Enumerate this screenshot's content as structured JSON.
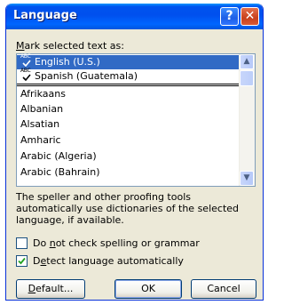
{
  "window": {
    "title": "Language",
    "help_glyph": "?",
    "close_glyph": "✕"
  },
  "list": {
    "label_mnemonic": "M",
    "label_rest": "ark selected text as:",
    "selected_items": [
      {
        "label": "English (U.S.)",
        "icon": "spell-check-icon",
        "selected": true
      },
      {
        "label": "Spanish (Guatemala)",
        "icon": "spell-check-icon",
        "selected": false
      }
    ],
    "items": [
      "Afrikaans",
      "Albanian",
      "Alsatian",
      "Amharic",
      "Arabic (Algeria)",
      "Arabic (Bahrain)"
    ],
    "abc_text": "ABC"
  },
  "info_text": "The speller and other proofing tools automatically use dictionaries of the selected language, if available.",
  "options": {
    "no_spell_check": {
      "pre": "Do ",
      "mnemonic": "n",
      "post": "ot check spelling or grammar",
      "checked": false
    },
    "detect_language": {
      "pre": "D",
      "mnemonic": "e",
      "post": "tect language automatically",
      "checked": true
    }
  },
  "buttons": {
    "default": {
      "mnemonic": "D",
      "rest": "efault..."
    },
    "ok": "OK",
    "cancel": "Cancel"
  },
  "colors": {
    "title_gradient": "#0050ee",
    "selection": "#316ac5",
    "close_button": "#c8401c",
    "checkmark": "#21a121"
  }
}
